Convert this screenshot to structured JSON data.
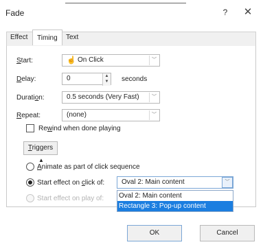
{
  "window": {
    "title": "Fade",
    "help_label": "?",
    "close_label": "✕"
  },
  "tabs": [
    {
      "label": "Effect"
    },
    {
      "label": "Timing"
    },
    {
      "label": "Text Animation"
    }
  ],
  "timing": {
    "start": {
      "label_pre": "",
      "label_u": "S",
      "label_post": "tart:",
      "value": "On Click"
    },
    "delay": {
      "label_pre": "",
      "label_u": "D",
      "label_post": "elay:",
      "value": "0",
      "unit": "seconds"
    },
    "duration": {
      "label_pre": "Durati",
      "label_u": "o",
      "label_post": "n:",
      "value": "0.5 seconds (Very Fast)"
    },
    "repeat": {
      "label_pre": "",
      "label_u": "R",
      "label_post": "epeat:",
      "value": "(none)"
    },
    "rewind": {
      "label_pre": "Re",
      "label_u": "w",
      "label_post": "ind when done playing",
      "checked": false
    }
  },
  "triggers": {
    "button_label_u": "T",
    "button_label_post": "riggers",
    "icon": "double-chevron-up-icon",
    "options": {
      "animate_click_sequence": {
        "label_pre": "",
        "label_u": "A",
        "label_post": "nimate as part of click sequence",
        "checked": false
      },
      "start_on_click_of": {
        "label_pre": "Start effect on ",
        "label_u": "c",
        "label_post": "lick of:",
        "checked": true
      },
      "start_on_play_of": {
        "label": "Start effect on play of:",
        "checked": false,
        "disabled": true
      }
    },
    "click_of_value": "Oval 2: Main content",
    "dropdown_items": [
      {
        "label": "Oval 2: Main content",
        "selected": false
      },
      {
        "label": "Rectangle 3: Pop-up content",
        "selected": true
      }
    ]
  },
  "buttons": {
    "ok_label": "OK",
    "cancel_label": "Cancel"
  },
  "colors": {
    "accent": "#1b7ee0",
    "panel": "#f0f0f0"
  }
}
